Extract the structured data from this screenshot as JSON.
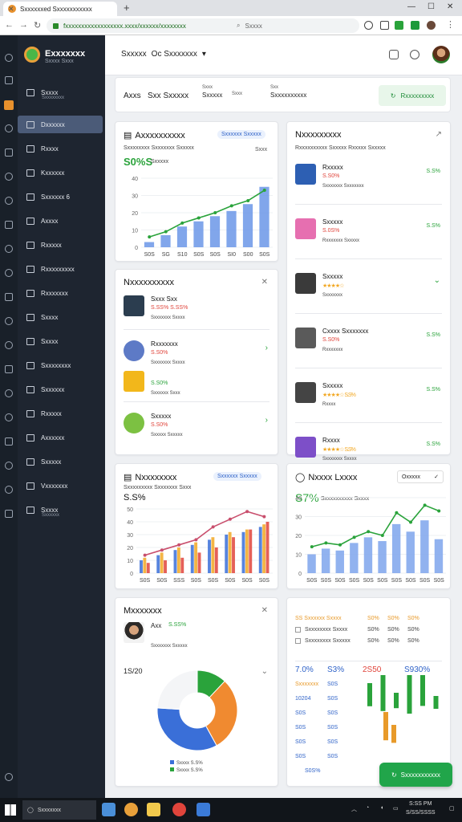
{
  "browser": {
    "tab_title": "Sxxxxxxed Sxxxxxxxxxxx",
    "url": "fxxxxxxxxxxxxxxxxxx.xxxx/xxxxxx/xxxxxxxx",
    "search": "Sxxxx"
  },
  "sidebar": {
    "brand": "Exxxxxxx",
    "brand_sub": "Sxxxx Sxxx",
    "items": [
      {
        "label": "Sxxxx",
        "sub": "Sxxxxxxxx"
      },
      {
        "label": "Dxxxxxx"
      },
      {
        "label": "Rxxxx"
      },
      {
        "label": "Kxxxxxx"
      },
      {
        "label": "Sxxxxxx 6"
      },
      {
        "label": "Axxxx"
      },
      {
        "label": "Rxxxxx"
      },
      {
        "label": "Rxxxxxxxxx"
      },
      {
        "label": "Rxxxxxxx"
      },
      {
        "label": "Sxxxx"
      },
      {
        "label": "Sxxxx"
      },
      {
        "label": "Sxxxxxxxx"
      },
      {
        "label": "Sxxxxxx"
      },
      {
        "label": "Rxxxxx"
      },
      {
        "label": "Axxxxxx"
      },
      {
        "label": "Sxxxxx"
      },
      {
        "label": "Vxxxxxxx"
      },
      {
        "label": "Sxxxx",
        "sub": "Sxxxxxx"
      }
    ]
  },
  "header": {
    "section": "Sxxxxx",
    "dropdown": "Oc Sxxxxxxx"
  },
  "stats": {
    "s1_top": "",
    "s1_main": "Axxs",
    "s2_main": "Sxx Sxxxxx",
    "s3_top": "Sxxx",
    "s3_main": "Sxxxxx",
    "s3_extra": "Sxxx",
    "s4_top": "Sxx",
    "s4_main": "Sxxxxxxxxxx",
    "action": "Rxxxxxxxxx"
  },
  "card_app": {
    "title": "Axxxxxxxxxx",
    "pill": "Sxxxxxx Sxxxxx",
    "subtitle": "Sxxxxxxxx Sxxxxxxx Sxxxxx",
    "corner": "Sxxx",
    "big": "S0%S",
    "big_sub": "Sxxxxx"
  },
  "chart_app": {
    "type": "bar",
    "categories": [
      "S0S",
      "SG",
      "S10",
      "S0S",
      "S0S",
      "SI0",
      "S00",
      "S0S"
    ],
    "values": [
      3,
      7,
      12,
      15,
      18,
      21,
      25,
      35
    ],
    "line": [
      6,
      9,
      14,
      17,
      20,
      24,
      27,
      33
    ],
    "ylim": [
      0,
      40
    ],
    "ticks": [
      "0",
      "10",
      "20",
      "30",
      "40"
    ]
  },
  "card_top_right": {
    "title": "Nxxxxxxxxx",
    "subtitle": "Rxxxxxxxxxx Sxxxxx Rxxxxx Sxxxxx",
    "items": [
      {
        "name": "Rxxxxx",
        "meta": "S.S0%",
        "sub": "Sxxxxxxx Sxxxxxxx",
        "pct": "S.S%",
        "color": "#2d5fb3"
      },
      {
        "name": "Sxxxxx",
        "meta": "S.0S%",
        "sub": "Rxxxxxxx Sxxxxx",
        "pct": "S.S%",
        "color": "#e66fb0"
      },
      {
        "name": "Sxxxxx",
        "meta": "★★★★☆",
        "sub": "Sxxxxxxx",
        "pct": "",
        "color": "#3a3a3a"
      },
      {
        "name": "Cxxxx Sxxxxxxx",
        "meta": "S.S0%",
        "sub": "Rxxxxxxx",
        "pct": "S.S%",
        "color": "#5a5a5a"
      },
      {
        "name": "Sxxxxx",
        "meta": "★★★★☆ S.S%",
        "sub": "Rxxxx",
        "pct": "S.S%",
        "color": "#444"
      },
      {
        "name": "Rxxxx",
        "meta": "★★★★☆ S.S%",
        "sub": "Sxxxxxxx Sxxxx",
        "pct": "S.S%",
        "color": "#7d4fc8"
      }
    ]
  },
  "card_notif": {
    "title": "Nxxxxxxxxxx",
    "items": [
      {
        "name": "Sxxx Sxx",
        "meta": "S.SS%  S.SS%",
        "sub": "Sxxxxxxx Sxxxx",
        "color": "#2b3d4f"
      },
      {
        "name": "Rxxxxxxx",
        "meta": "S.S0%",
        "sub": "Sxxxxxxx Sxxxx",
        "color": "#5d7ac6"
      },
      {
        "name": "",
        "meta": "S.S0%",
        "sub": "Sxxxxxx Sxxx",
        "color": "#f2b71b"
      },
      {
        "name": "Sxxxxx",
        "meta": "S.S0%",
        "sub": "Sxxxxx Sxxxxx",
        "color": "#7cc142"
      }
    ]
  },
  "card_nav": {
    "title": "Nxxxxxxxx",
    "pill": "Sxxxxxx Sxxxxx",
    "subtitle": "Sxxxxxxxxx Sxxxxxxx Sxxx",
    "big": "S.S%"
  },
  "chart_nav": {
    "type": "bar",
    "categories": [
      "S0S",
      "S0S",
      "SSS",
      "S0S",
      "S0S",
      "S0S",
      "S0S",
      "S0S"
    ],
    "series": [
      {
        "values": [
          10,
          14,
          18,
          22,
          26,
          30,
          32,
          36
        ],
        "color": "#3a6fd8"
      },
      {
        "values": [
          12,
          16,
          20,
          24,
          28,
          32,
          34,
          38
        ],
        "color": "#f2a824"
      },
      {
        "values": [
          8,
          10,
          12,
          16,
          20,
          28,
          34,
          40
        ],
        "color": "#e0443b"
      }
    ],
    "line": [
      14,
      18,
      22,
      26,
      36,
      42,
      48,
      44
    ],
    "ylim": [
      0,
      50
    ],
    "ticks": [
      "0",
      "10",
      "20",
      "30",
      "40",
      "50"
    ]
  },
  "card_nexus": {
    "title": "Nxxxx Lxxxx",
    "dropdown": "Oxxxxx",
    "big": "S7%",
    "subtitle": "Sxxxxxxxxxx Sxxxx"
  },
  "chart_nexus": {
    "type": "bar",
    "categories": [
      "S0S",
      "S0S",
      "S0S",
      "S0S",
      "S0S",
      "S0S",
      "S0S",
      "S0S",
      "S0S",
      "S0S"
    ],
    "values": [
      10,
      13,
      12,
      16,
      19,
      17,
      26,
      22,
      28,
      18
    ],
    "line": [
      14,
      16,
      15,
      19,
      22,
      20,
      32,
      27,
      36,
      33
    ],
    "ylim": [
      0,
      40
    ],
    "ticks": [
      "0",
      "10",
      "20",
      "30",
      "40"
    ]
  },
  "card_market": {
    "title": "Mxxxxxxx",
    "item_name": "Axx",
    "item_meta": "S.SS%",
    "item_sub": "Sxxxxxxx Sxxxxx",
    "label": "1S/20"
  },
  "chart_pie": {
    "type": "pie",
    "slices": [
      {
        "value": 12,
        "color": "#2aa33b"
      },
      {
        "value": 30,
        "color": "#f08a30"
      },
      {
        "value": 34,
        "color": "#3a6fd8"
      },
      {
        "value": 24,
        "color": "#f4f5f7"
      }
    ],
    "legend": [
      "Sxxxx S.S%",
      "Sxxxx S.S%"
    ]
  },
  "card_table": {
    "header": "SS Sxxxxxx Sxxxx",
    "head_vals": [
      "S0%",
      "S0%",
      "S0%"
    ],
    "rows": [
      {
        "label": "Sxxxxxxxx Sxxxx",
        "vals": [
          "S0%",
          "S0%",
          "S0%"
        ]
      },
      {
        "label": "Sxxxxxxxx Sxxxxx",
        "vals": [
          "S0%",
          "S0%",
          "S0%"
        ]
      }
    ],
    "kpis": [
      "7.0%",
      "S3%",
      "2S50",
      "S930%"
    ],
    "rows2": [
      {
        "label": "Sxxxxxxx",
        "v1": "S0S"
      },
      {
        "label": "10204",
        "v1": "S0S"
      },
      {
        "label": "S0S",
        "v1": "S0S"
      },
      {
        "label": "S0S",
        "v1": "S0S"
      },
      {
        "label": "S0S",
        "v1": "S0S"
      },
      {
        "label": "S0S",
        "v1": "S0S"
      }
    ],
    "foot": "S0S%"
  },
  "chart_table": {
    "type": "bar",
    "values": [
      18,
      28,
      12,
      30,
      24,
      10,
      22,
      14
    ],
    "colors": [
      "#2aa33b",
      "#2aa33b",
      "#2aa33b",
      "#2aa33b",
      "#2aa33b",
      "#2aa33b",
      "#e89a2a",
      "#e89a2a"
    ],
    "ylim": [
      0,
      40
    ]
  },
  "fab": "Sxxxxxxxxxxx",
  "taskbar": {
    "search": "Sxxxxxxx",
    "time": "S:SS PM",
    "date": "S/SS/SSSS"
  }
}
